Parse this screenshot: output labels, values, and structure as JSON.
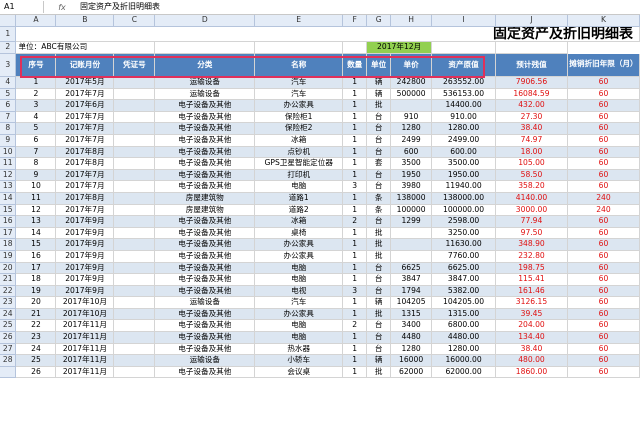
{
  "formula_bar": {
    "cell_ref": "A1",
    "fx": "fx",
    "content": "固定资产及折旧明细表"
  },
  "columns": [
    "A",
    "B",
    "C",
    "D",
    "E",
    "F",
    "G",
    "H",
    "I",
    "J",
    "K"
  ],
  "title": "固定资产及折旧明细表",
  "company_label": "单位：ABC有限公司",
  "period": "2017年12月",
  "headers": [
    "序号",
    "记账月份",
    "凭证号",
    "分类",
    "名称",
    "数量",
    "单位",
    "单价",
    "资产原值",
    "预计残值",
    "摊销折旧年限（月）"
  ],
  "row_numbers": [
    "1",
    "2",
    "3",
    "4",
    "5",
    "6",
    "7",
    "8",
    "9",
    "10",
    "11",
    "12",
    "13",
    "14",
    "15",
    "16",
    "17",
    "18",
    "19",
    "20",
    "21",
    "22",
    "23",
    "24",
    "25",
    "26",
    "27",
    "28"
  ],
  "rows": [
    [
      "1",
      "2017年5月",
      "",
      "运输设备",
      "汽车",
      "1",
      "辆",
      "242800",
      "263552.00",
      "7906.56",
      "60"
    ],
    [
      "2",
      "2017年7月",
      "",
      "运输设备",
      "汽车",
      "1",
      "辆",
      "500000",
      "536153.00",
      "16084.59",
      "60"
    ],
    [
      "3",
      "2017年6月",
      "",
      "电子设备及其他",
      "办公家具",
      "1",
      "批",
      "",
      "14400.00",
      "432.00",
      "60"
    ],
    [
      "4",
      "2017年7月",
      "",
      "电子设备及其他",
      "保险柜1",
      "1",
      "台",
      "910",
      "910.00",
      "27.30",
      "60"
    ],
    [
      "5",
      "2017年7月",
      "",
      "电子设备及其他",
      "保险柜2",
      "1",
      "台",
      "1280",
      "1280.00",
      "38.40",
      "60"
    ],
    [
      "6",
      "2017年7月",
      "",
      "电子设备及其他",
      "冰箱",
      "1",
      "台",
      "2499",
      "2499.00",
      "74.97",
      "60"
    ],
    [
      "7",
      "2017年8月",
      "",
      "电子设备及其他",
      "点钞机",
      "1",
      "台",
      "600",
      "600.00",
      "18.00",
      "60"
    ],
    [
      "8",
      "2017年8月",
      "",
      "电子设备及其他",
      "GPS卫星智能定位器",
      "1",
      "套",
      "3500",
      "3500.00",
      "105.00",
      "60"
    ],
    [
      "9",
      "2017年7月",
      "",
      "电子设备及其他",
      "打印机",
      "1",
      "台",
      "1950",
      "1950.00",
      "58.50",
      "60"
    ],
    [
      "10",
      "2017年7月",
      "",
      "电子设备及其他",
      "电脑",
      "3",
      "台",
      "3980",
      "11940.00",
      "358.20",
      "60"
    ],
    [
      "11",
      "2017年8月",
      "",
      "房屋建筑物",
      "道路1",
      "1",
      "条",
      "138000",
      "138000.00",
      "4140.00",
      "240"
    ],
    [
      "12",
      "2017年7月",
      "",
      "房屋建筑物",
      "道路2",
      "1",
      "条",
      "100000",
      "100000.00",
      "3000.00",
      "240"
    ],
    [
      "13",
      "2017年9月",
      "",
      "电子设备及其他",
      "冰箱",
      "2",
      "台",
      "1299",
      "2598.00",
      "77.94",
      "60"
    ],
    [
      "14",
      "2017年9月",
      "",
      "电子设备及其他",
      "桌椅",
      "1",
      "批",
      "",
      "3250.00",
      "97.50",
      "60"
    ],
    [
      "15",
      "2017年9月",
      "",
      "电子设备及其他",
      "办公家具",
      "1",
      "批",
      "",
      "11630.00",
      "348.90",
      "60"
    ],
    [
      "16",
      "2017年9月",
      "",
      "电子设备及其他",
      "办公家具",
      "1",
      "批",
      "",
      "7760.00",
      "232.80",
      "60"
    ],
    [
      "17",
      "2017年9月",
      "",
      "电子设备及其他",
      "电脑",
      "1",
      "台",
      "6625",
      "6625.00",
      "198.75",
      "60"
    ],
    [
      "18",
      "2017年9月",
      "",
      "电子设备及其他",
      "电脑",
      "1",
      "台",
      "3847",
      "3847.00",
      "115.41",
      "60"
    ],
    [
      "19",
      "2017年9月",
      "",
      "电子设备及其他",
      "电视",
      "3",
      "台",
      "1794",
      "5382.00",
      "161.46",
      "60"
    ],
    [
      "20",
      "2017年10月",
      "",
      "运输设备",
      "汽车",
      "1",
      "辆",
      "104205",
      "104205.00",
      "3126.15",
      "60"
    ],
    [
      "21",
      "2017年10月",
      "",
      "电子设备及其他",
      "办公家具",
      "1",
      "批",
      "1315",
      "1315.00",
      "39.45",
      "60"
    ],
    [
      "22",
      "2017年11月",
      "",
      "电子设备及其他",
      "电脑",
      "2",
      "台",
      "3400",
      "6800.00",
      "204.00",
      "60"
    ],
    [
      "23",
      "2017年11月",
      "",
      "电子设备及其他",
      "电脑",
      "1",
      "台",
      "4480",
      "4480.00",
      "134.40",
      "60"
    ],
    [
      "24",
      "2017年11月",
      "",
      "电子设备及其他",
      "热水器",
      "1",
      "台",
      "1280",
      "1280.00",
      "38.40",
      "60"
    ],
    [
      "25",
      "2017年11月",
      "",
      "运输设备",
      "小轿车",
      "1",
      "辆",
      "16000",
      "16000.00",
      "480.00",
      "60"
    ],
    [
      "26",
      "2017年11月",
      "",
      "电子设备及其他",
      "会议桌",
      "1",
      "批",
      "62000",
      "62000.00",
      "1860.00",
      "60"
    ]
  ],
  "colors": {
    "header_fill": "#4f81bd",
    "stripe": "#dce6f1",
    "period_fill": "#92d050",
    "red_text": "#e01010",
    "selection_border": "#e0305a"
  }
}
